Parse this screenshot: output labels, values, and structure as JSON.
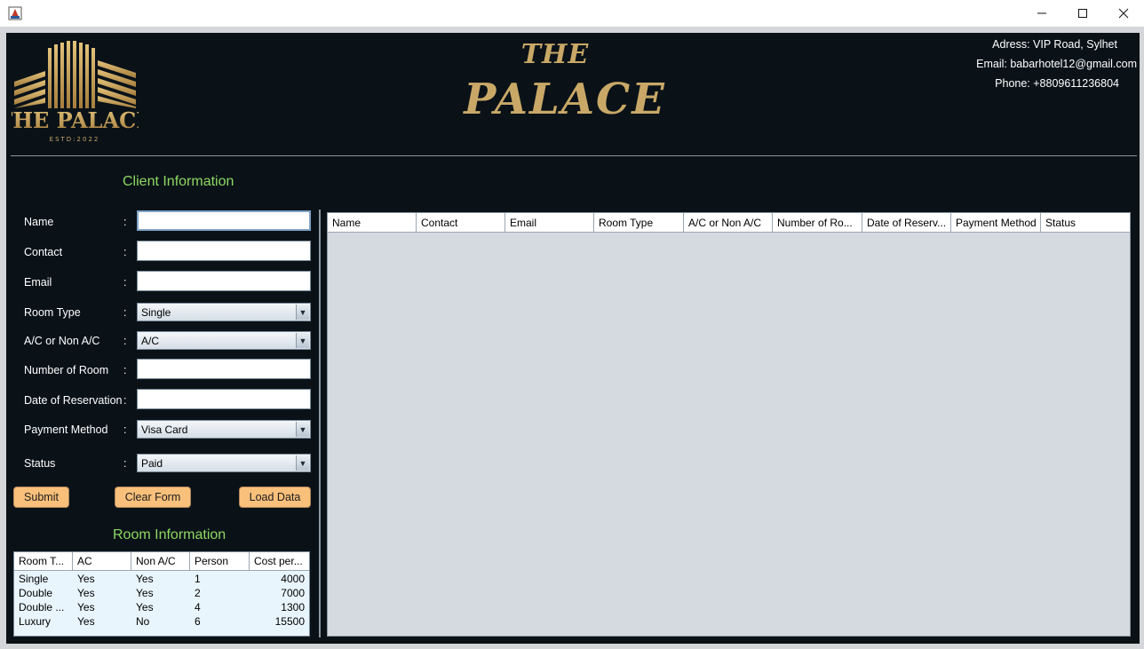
{
  "window": {
    "minimize": "—",
    "maximize": "☐",
    "close": "✕"
  },
  "header": {
    "logo_text": "THE PALACE",
    "logo_sub": "ESTD:2022",
    "brand_the": "THE",
    "brand_palace": "PALACE",
    "address": "Adress: VIP Road, Sylhet",
    "email": "Email: babarhotel12@gmail.com",
    "phone": "Phone: +8809611236804",
    "accent": "#c9a867"
  },
  "client": {
    "title": "Client Information",
    "fields": {
      "name": {
        "label": "Name",
        "value": ""
      },
      "contact": {
        "label": "Contact",
        "value": ""
      },
      "email": {
        "label": "Email",
        "value": ""
      },
      "room_type": {
        "label": "Room Type",
        "value": "Single"
      },
      "ac": {
        "label": "A/C or Non A/C",
        "value": "A/C"
      },
      "rooms": {
        "label": "Number of Room",
        "value": ""
      },
      "date": {
        "label": "Date of Reservation",
        "value": ""
      },
      "payment": {
        "label": "Payment Method",
        "value": "Visa Card"
      },
      "status": {
        "label": "Status",
        "value": "Paid"
      }
    },
    "colon": ":",
    "buttons": {
      "submit": "Submit",
      "clear": "Clear Form",
      "load": "Load Data"
    }
  },
  "room_info": {
    "title": "Room Information",
    "columns": [
      "Room T...",
      "AC",
      "Non A/C",
      "Person",
      "Cost per..."
    ],
    "rows": [
      [
        "Single",
        "Yes",
        "Yes",
        "1",
        "4000"
      ],
      [
        "Double",
        "Yes",
        "Yes",
        "2",
        "7000"
      ],
      [
        "Double ...",
        "Yes",
        "Yes",
        "4",
        "1300"
      ],
      [
        "Luxury",
        "Yes",
        "No",
        "6",
        "15500"
      ]
    ]
  },
  "reservations": {
    "columns": [
      "Name",
      "Contact",
      "Email",
      "Room Type",
      "A/C or Non A/C",
      "Number of Ro...",
      "Date of Reserv...",
      "Payment Method",
      "Status"
    ],
    "rows": []
  }
}
